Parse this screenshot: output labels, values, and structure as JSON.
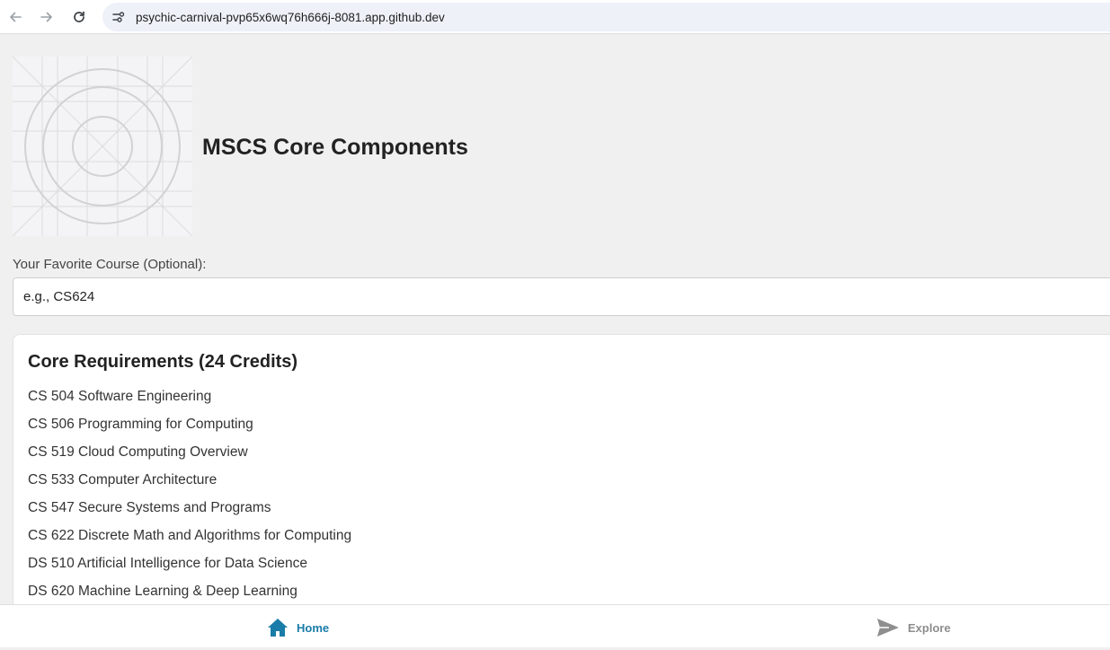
{
  "browser": {
    "url": "psychic-carnival-pvp65x6wq76h666j-8081.app.github.dev",
    "back_icon": "arrow-left-icon",
    "forward_icon": "arrow-right-icon",
    "reload_icon": "reload-icon",
    "site_info_icon": "tune-icon"
  },
  "header": {
    "title": "MSCS Core Components",
    "image_icon": "concentric-circles-grid-placeholder"
  },
  "favorite": {
    "label": "Your Favorite Course (Optional):",
    "placeholder": "e.g., CS624",
    "value": ""
  },
  "core": {
    "title": "Core Requirements (24 Credits)",
    "courses": [
      "CS 504 Software Engineering",
      "CS 506 Programming for Computing",
      "CS 519 Cloud Computing Overview",
      "CS 533 Computer Architecture",
      "CS 547 Secure Systems and Programs",
      "CS 622 Discrete Math and Algorithms for Computing",
      "DS 510 Artificial Intelligence for Data Science",
      "DS 620 Machine Learning & Deep Learning"
    ]
  },
  "tabs": [
    {
      "label": "Home",
      "icon": "home-icon",
      "active": true
    },
    {
      "label": "Explore",
      "icon": "send-icon",
      "active": false
    }
  ],
  "colors": {
    "accent": "#1a7ca8",
    "inactive": "#8e8e8e",
    "page_bg": "#f0f0f0"
  }
}
